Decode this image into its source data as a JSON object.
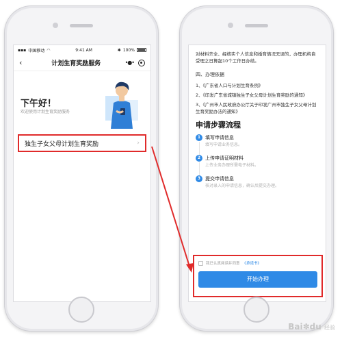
{
  "left_phone": {
    "status": {
      "carrier": "中国移动",
      "time": "9:41 AM",
      "battery": "100%"
    },
    "nav": {
      "title": "计划生育奖励服务"
    },
    "greeting": "下午好！",
    "welcome": "欢迎使用计划生育奖励服务",
    "service_item": "独生子女父母计划生育奖励"
  },
  "right_phone": {
    "intro": "对材料齐全、经核实个人信息和婚育情况无误的，办理机构自受理之日算起10个工作日办结。",
    "basis_heading": "四、办理依据",
    "basis_items": [
      "1、《广东省人口与计划生育条例》",
      "2、《印发广东省城镇独生子女父母计划生育奖励的通知》",
      "3、《广州市人民政府办公厅关于印发广州市独生子女父母计划生育奖励办法的通知》"
    ],
    "steps_title": "申请步骤流程",
    "steps": [
      {
        "num": "1",
        "title": "填写申请信息",
        "desc": "填写申请业务信息。"
      },
      {
        "num": "2",
        "title": "上传申请证明材料",
        "desc": "上传业务办理所需电子材料。"
      },
      {
        "num": "3",
        "title": "提交申请信息",
        "desc": "核对录入的申请信息，确认后提交办理。"
      }
    ],
    "agree_text": "我已认真阅读并同意",
    "agree_link": "《承诺书》",
    "start_button": "开始办理"
  },
  "watermark": {
    "brand": "Bai",
    "brand2": "du",
    "sub": "经验"
  },
  "colors": {
    "accent_blue": "#2f8ae6",
    "highlight_red": "#e02a2a"
  }
}
